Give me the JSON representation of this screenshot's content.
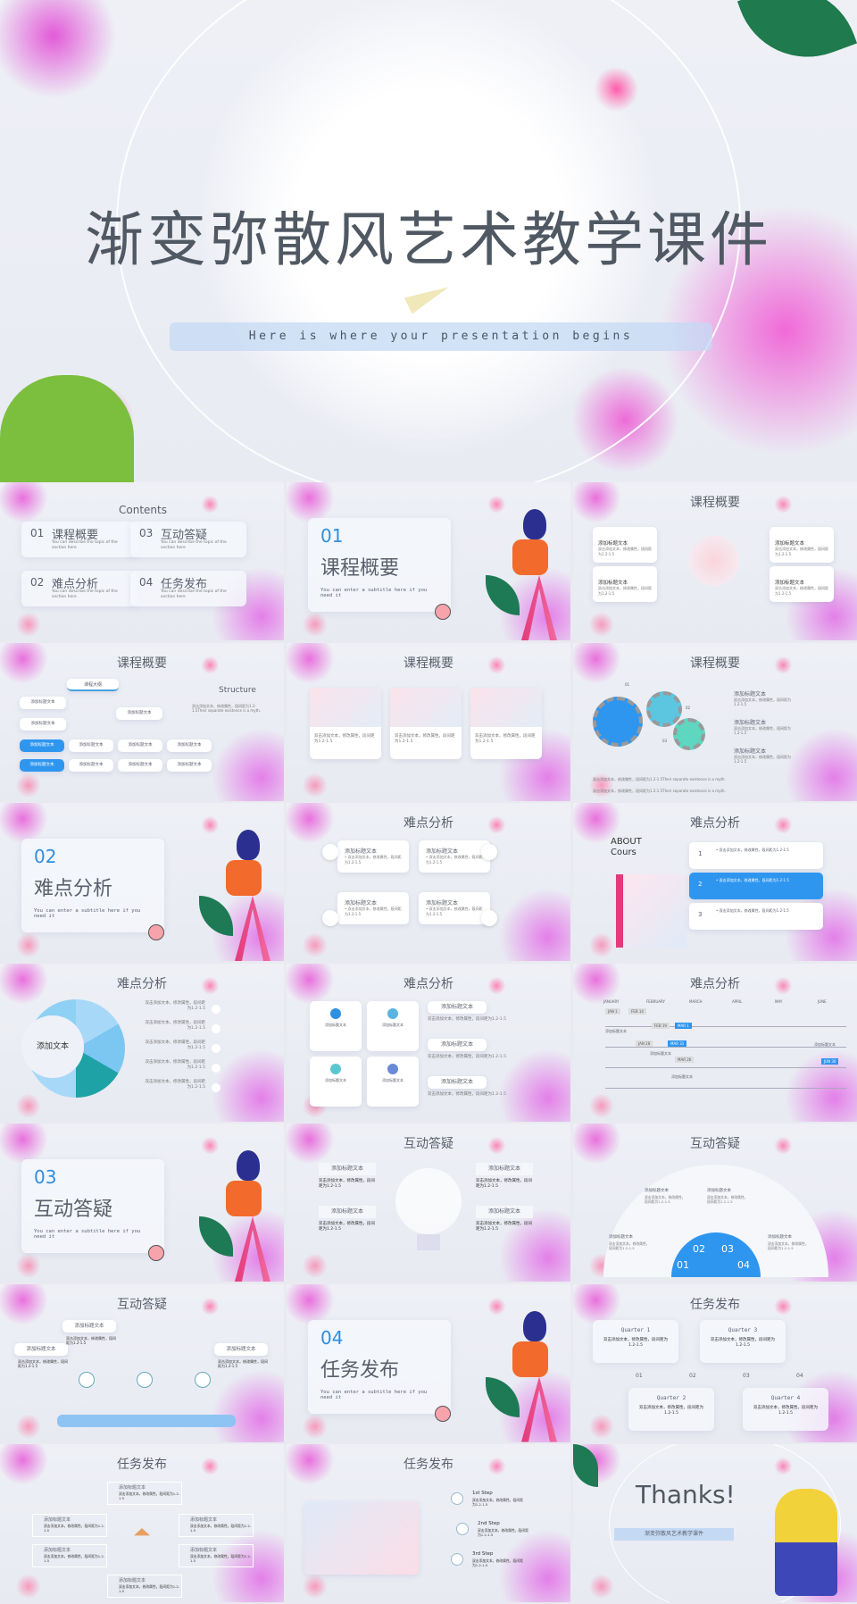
{
  "hero": {
    "title": "渐变弥散风艺术教学课件",
    "subtitle": "Here is where your presentation begins"
  },
  "common": {
    "add_title": "添加标题文本",
    "body": "双击添加文本，修改属性，段间距为1.2-1.5",
    "section_subtitle": "You can enter a subtitle here if you need it"
  },
  "contents": {
    "title": "Contents",
    "desc": "You can describe the topic of the section here",
    "items": [
      {
        "num": "01",
        "label": "课程概要"
      },
      {
        "num": "03",
        "label": "互动答疑"
      },
      {
        "num": "02",
        "label": "难点分析"
      },
      {
        "num": "04",
        "label": "任务发布"
      }
    ]
  },
  "sections": [
    {
      "num": "01",
      "label": "课程概要"
    },
    {
      "num": "02",
      "label": "难点分析"
    },
    {
      "num": "03",
      "label": "互动答疑"
    },
    {
      "num": "04",
      "label": "任务发布"
    }
  ],
  "structure": {
    "root": "课程大纲",
    "heading": "Structure",
    "body": "双击添加文本，修改属性，段间距为1.2-1.5Their separate existence is a myth."
  },
  "gears": {
    "labels": [
      "01",
      "02",
      "03"
    ],
    "footer": "双击添加文本，修改属性，段间距为1.2-1.5Their separate existence is a myth."
  },
  "about": {
    "line1": "ABOUT",
    "line2": "Cours",
    "items": [
      "1",
      "2",
      "3"
    ]
  },
  "pie": {
    "center": "添加文本"
  },
  "timeline": {
    "months": [
      "JANUARY",
      "FEBRUARY",
      "MARCH",
      "APRIL",
      "MAY",
      "JUNE"
    ],
    "tags": [
      "JAN 1",
      "FEB 14",
      "FEB 19",
      "MAR 1",
      "JAN 28",
      "MAR 31",
      "MAR 26",
      "JUN 30"
    ]
  },
  "semicircle": {
    "nums": [
      "01",
      "02",
      "03",
      "04"
    ]
  },
  "quarters": {
    "labels": [
      "Quarter 1",
      "Quarter 3",
      "Quarter 2",
      "Quarter 4"
    ],
    "steps": [
      "01",
      "02",
      "03",
      "04"
    ]
  },
  "steps": {
    "labels": [
      "1st Step",
      "2nd Step",
      "3rd Step"
    ]
  },
  "thanks": {
    "title": "Thanks!",
    "subtitle": "渐变弥散风艺术教学课件"
  },
  "colors": {
    "accent": "#2f96f0",
    "text": "#505963",
    "band": "#c4daf4"
  }
}
